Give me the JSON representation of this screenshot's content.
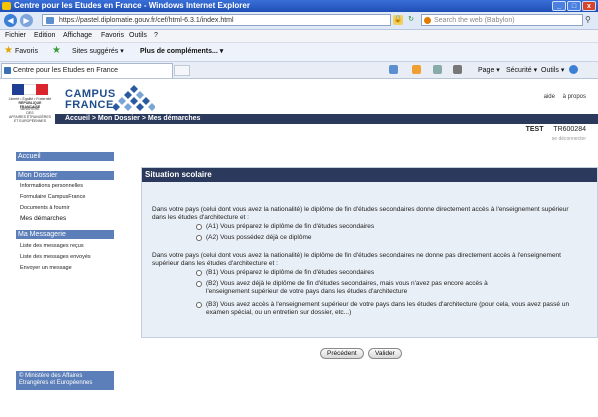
{
  "browser": {
    "title": "Centre pour les Etudes en France - Windows Internet Explorer",
    "url": "https://pastel.diplomatie.gouv.fr/cef/html-6.3.1/index.html",
    "search_placeholder": "Search the web (Babylon)",
    "menu": [
      "Fichier",
      "Edition",
      "Affichage",
      "Favoris",
      "Outils",
      "?"
    ],
    "favorites": {
      "favoris": "Favoris",
      "sites_suggeres": "Sites suggérés ▾",
      "plus_complements": "Plus de compléments... ▾"
    },
    "tab_title": "Centre pour les Etudes en France",
    "commands": {
      "page": "Page ▾",
      "securite": "Sécurité ▾",
      "outils": "Outils ▾"
    },
    "window_buttons": {
      "minimize": "_",
      "maximize": "□",
      "close": "x"
    }
  },
  "site": {
    "logo_text_line1": "CAMPUS",
    "logo_text_line2": "FRANCE",
    "emblem": {
      "line1": "Liberté • Égalité • Fraternité",
      "line2": "RÉPUBLIQUE FRANÇAISE",
      "line3": "MINISTÈRE",
      "line4": "DES",
      "line5": "AFFAIRES ÉTRANGÈRES",
      "line6": "ET EUROPÉENNES"
    },
    "top_links": [
      "aide",
      "à propos"
    ],
    "breadcrumb": "Accueil > Mon Dossier > Mes démarches",
    "user": {
      "name": "TEST",
      "id": "TR600284"
    },
    "disconnect": "se déconnecter"
  },
  "sidebar": {
    "accueil": "Accueil",
    "mon_dossier": "Mon Dossier",
    "dossier_links": [
      "Informations personnelles",
      "Formulaire CampusFrance",
      "Documents à fournir",
      "Mes démarches"
    ],
    "ma_messagerie": "Ma Messagerie",
    "message_links": [
      "Liste des messages reçus",
      "Liste des messages envoyés",
      "Envoyer un message"
    ],
    "footer": "© Ministère des Affaires Etrangères et Européennes"
  },
  "panel": {
    "title": "Situation scolaire",
    "q1": "Dans votre pays (celui dont vous avez la nationalité) le diplôme de fin d'études secondaires donne directement accès à l'enseignement supérieur dans les études d'architecture et :",
    "a1": "(A1) Vous préparez le diplôme de fin d'études secondaires",
    "a2": "(A2) Vous possédez déjà ce diplôme",
    "q2": "Dans votre pays (celui dont vous avez la nationalité) le diplôme de fin d'études secondaires ne donne pas directement accès à l'enseignement supérieur dans les études d'architecture et :",
    "b1": "(B1) Vous préparez le diplôme de fin d'études secondaires",
    "b2": "(B2) Vous avez déjà le diplôme de fin d'études secondaires, mais vous n'avez pas encore accès à l'enseignement supérieur de votre pays dans les études d'architecture",
    "b3": "(B3) Vous avez accès à l'enseignement supérieur de votre pays dans les études d'architecture (pour cela, vous avez passé un examen spécial, ou un entretien sur dossier, etc...)"
  },
  "buttons": {
    "previous": "Précédent",
    "next": "Valider"
  },
  "colors": {
    "navy": "#2b3a5c",
    "sidebar_blue": "#5c7fb9",
    "panel_bg": "#e9eff6"
  }
}
